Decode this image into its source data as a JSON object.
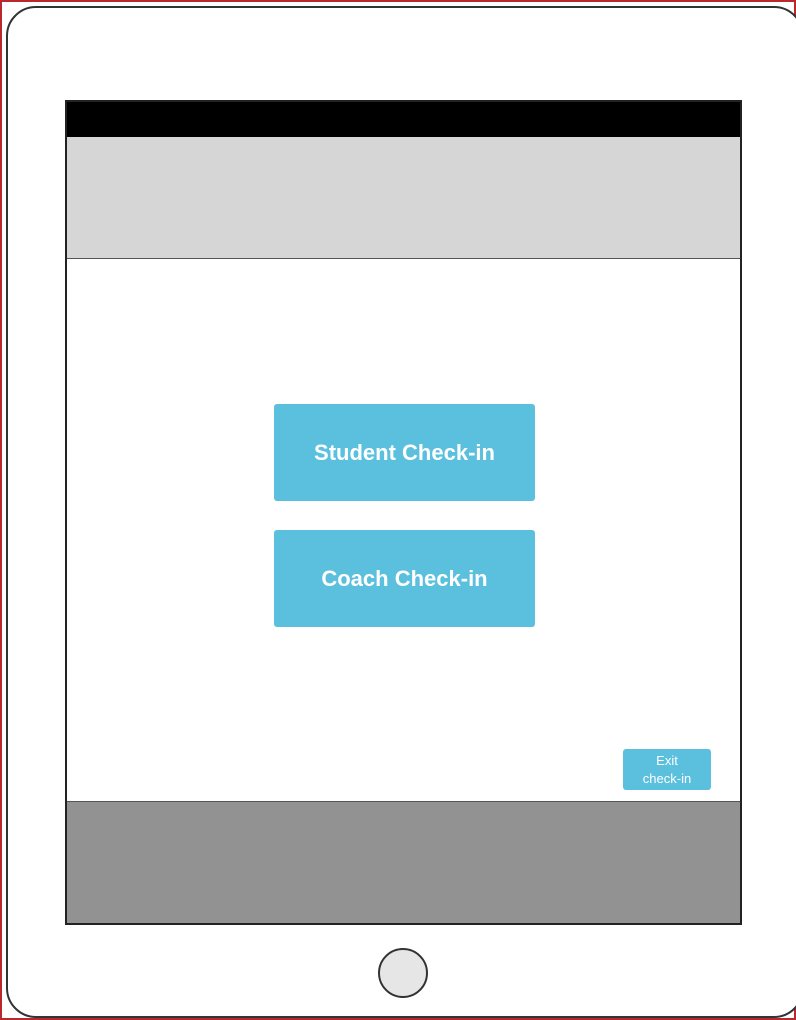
{
  "main": {
    "student_checkin_label": "Student Check-in",
    "coach_checkin_label": "Coach Check-in",
    "exit_line1": "Exit",
    "exit_line2": "check-in"
  },
  "colors": {
    "button_accent": "#5bc0de",
    "status_bar": "#000000",
    "header": "#d6d6d6",
    "footer": "#929292",
    "frame_outline": "#b8282d"
  },
  "icons": {
    "home": "home-button-circle"
  }
}
